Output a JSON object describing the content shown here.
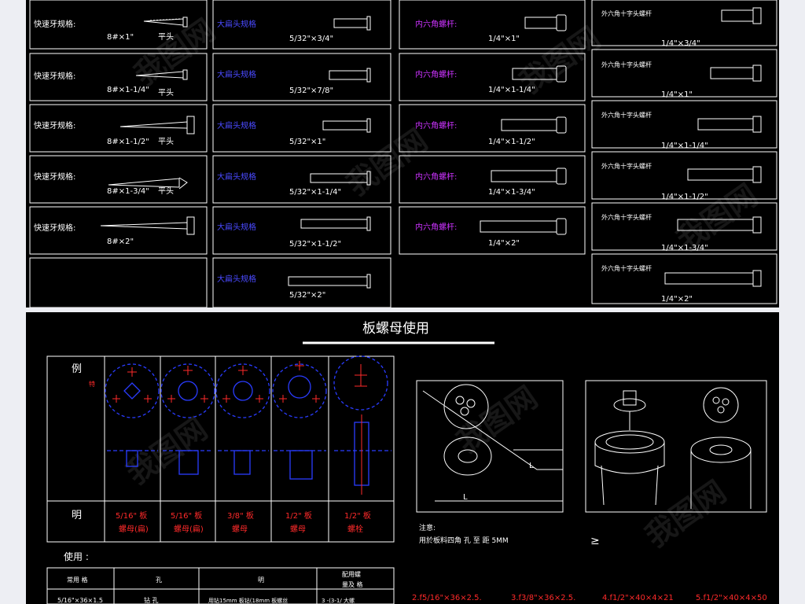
{
  "top": {
    "col1": {
      "label": "快速牙规格:",
      "rows": [
        {
          "spec": "8#×1\"",
          "head": "平头"
        },
        {
          "spec": "8#×1-1/4\"",
          "head": "平头"
        },
        {
          "spec": "8#×1-1/2\"",
          "head": "平头"
        },
        {
          "spec": "8#×1-3/4\"",
          "head": "平头"
        },
        {
          "spec": "8#×2\"",
          "head": ""
        }
      ]
    },
    "col2": {
      "label": "大扁头规格",
      "rows": [
        "5/32\"×3/4\"",
        "5/32\"×7/8\"",
        "5/32\"×1\"",
        "5/32\"×1-1/4\"",
        "5/32\"×1-1/2\"",
        "5/32\"×2\""
      ]
    },
    "col3": {
      "label": "内六角螺杆:",
      "rows": [
        "1/4\"×1\"",
        "1/4\"×1-1/4\"",
        "1/4\"×1-1/2\"",
        "1/4\"×1-3/4\"",
        "1/4\"×2\""
      ]
    },
    "col4": {
      "label": "外六角十字头螺杆",
      "rows": [
        "1/4\"×3/4\"",
        "1/4\"×1\"",
        "1/4\"×1-1/4\"",
        "1/4\"×1-1/2\"",
        "1/4\"×1-3/4\"",
        "1/4\"×2\""
      ]
    }
  },
  "bottom": {
    "title": "板螺母使用",
    "row_labels": {
      "example": "例",
      "note": "明"
    },
    "example_mark": "特",
    "nut_labels": [
      {
        "line1": "5/16\" 板",
        "line2": "螺母(扁)"
      },
      {
        "line1": "5/16\" 板",
        "line2": "螺母(扁)"
      },
      {
        "line1": "3/8\" 板",
        "line2": "螺母"
      },
      {
        "line1": "1/2\" 板",
        "line2": "螺母"
      },
      {
        "line1": "1/2\" 板",
        "line2": "螺栓"
      }
    ],
    "usage_label": "使用 :",
    "table_headers": [
      "常用 格",
      "孔",
      "明",
      "配用螺",
      "量及 格"
    ],
    "table_row": [
      "5/16\"×36×1.5",
      "钻 孔",
      "用钻15mm 板钻(18mm 板螺丝",
      "3 -(3-1/ 大螺"
    ],
    "notes_title": "注意:",
    "notes_text": "用於板料四角 孔 至   距 5MM",
    "symbol": "≥",
    "sizes": [
      "2.f5/16\"×36×2.5.",
      "3.f3/8\"×36×2.5.",
      "4.f1/2\"×40×4×21",
      "5.f1/2\"×40×4×50"
    ]
  },
  "colors": {
    "panel_bg": "#000000",
    "page_bg": "#edeef3",
    "line": "#ffffff",
    "blue_text": "#4a4aff",
    "magenta_text": "#cc33ff",
    "red_text": "#ff2a2a",
    "blue_drawing": "#2a3cff"
  }
}
